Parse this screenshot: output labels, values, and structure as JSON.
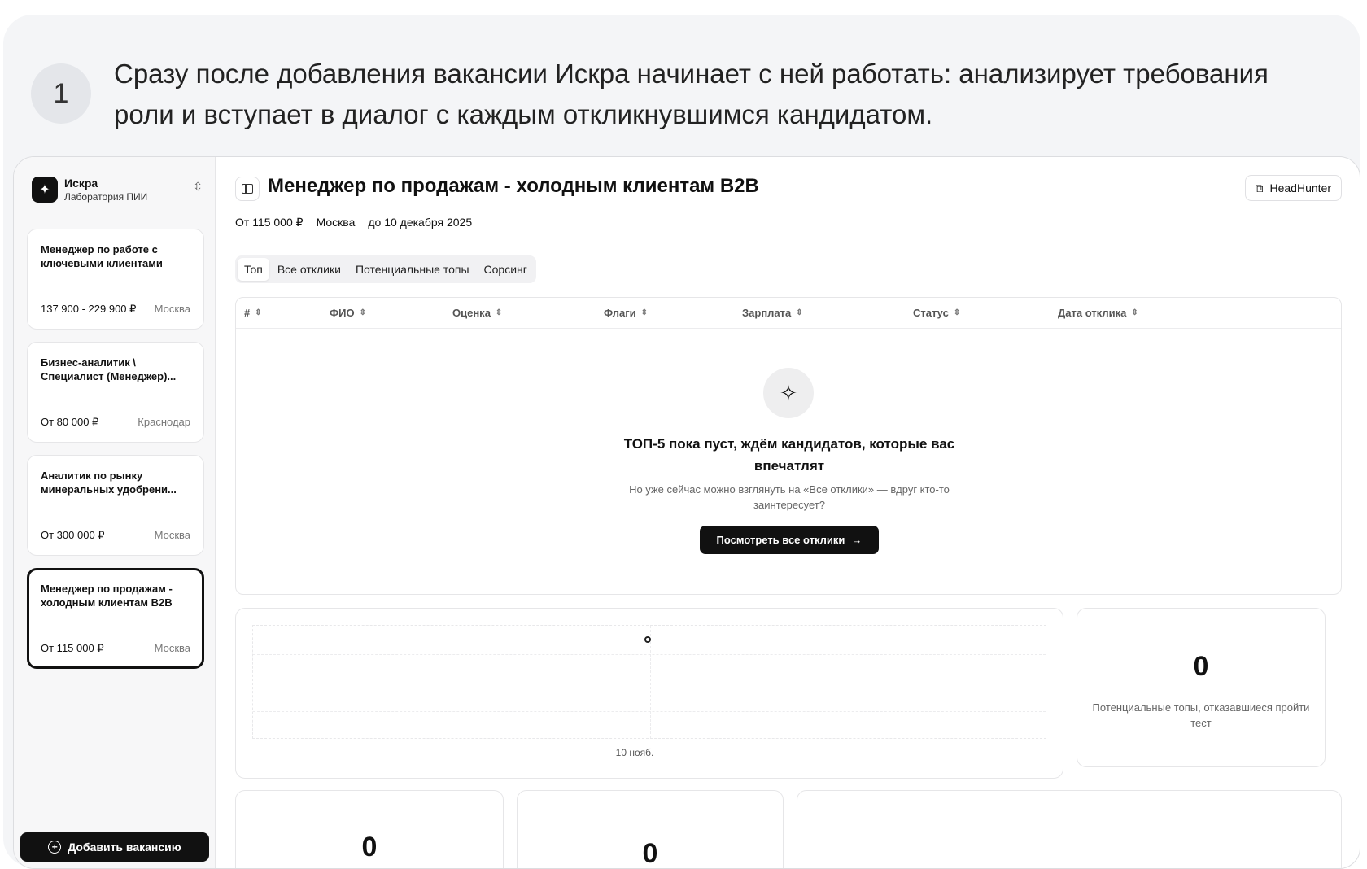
{
  "step": {
    "number": "1",
    "text": "Сразу после добавления вакансии Искра начинает с ней работать: анализирует требования роли и вступает в диалог с каждым откликнувшимся кандидатом."
  },
  "brand": {
    "name": "Искра",
    "subtitle": "Лаборатория ПИИ"
  },
  "vacancies": [
    {
      "title": "Менеджер по работе с ключевыми клиентами",
      "salary": "137 900 - 229 900 ₽",
      "city": "Москва"
    },
    {
      "title": "Бизнес-аналитик \\ Специалист (Менеджер)...",
      "salary": "От 80 000 ₽",
      "city": "Краснодар"
    },
    {
      "title": "Аналитик по рынку минеральных удобрени...",
      "salary": "От 300 000 ₽",
      "city": "Москва"
    },
    {
      "title": "Менеджер по продажам - холодным клиентам B2B",
      "salary": "От 115 000 ₽",
      "city": "Москва"
    }
  ],
  "add_vacancy_label": "Добавить вакансию",
  "header": {
    "title": "Менеджер по продажам - холодным клиентам B2B",
    "source_button": "HeadHunter",
    "salary": "От 115 000 ₽",
    "city": "Москва",
    "deadline": "до 10 декабря 2025"
  },
  "tabs": [
    "Топ",
    "Все отклики",
    "Потенциальные топы",
    "Сорсинг"
  ],
  "table": {
    "columns": [
      "#",
      "ФИО",
      "Оценка",
      "Флаги",
      "Зарплата",
      "Статус",
      "Дата отклика"
    ],
    "empty_title": "ТОП-5 пока пуст, ждём кандидатов, которые вас впечатлят",
    "empty_subtitle": "Но уже сейчас можно взглянуть на «Все отклики» — вдруг кто-то заинтересует?",
    "empty_button": "Посмотреть все отклики"
  },
  "chart_data": {
    "type": "line",
    "x": [
      "10 нояб."
    ],
    "series": [
      {
        "values": [
          0
        ]
      }
    ]
  },
  "stats": {
    "refused_count": "0",
    "refused_label": "Потенциальные топы, отказавшиеся пройти тест",
    "bottom_a": "0",
    "bottom_b": "0"
  },
  "icons": {
    "brand": "sparkle-icon",
    "toggle": "chevron-updown-icon",
    "collapse": "sidebar-toggle-icon",
    "external": "external-link-icon",
    "empty": "sparkles-icon",
    "arrow": "arrow-right-icon",
    "plus": "plus-circle-icon",
    "sort": "sort-icon"
  }
}
